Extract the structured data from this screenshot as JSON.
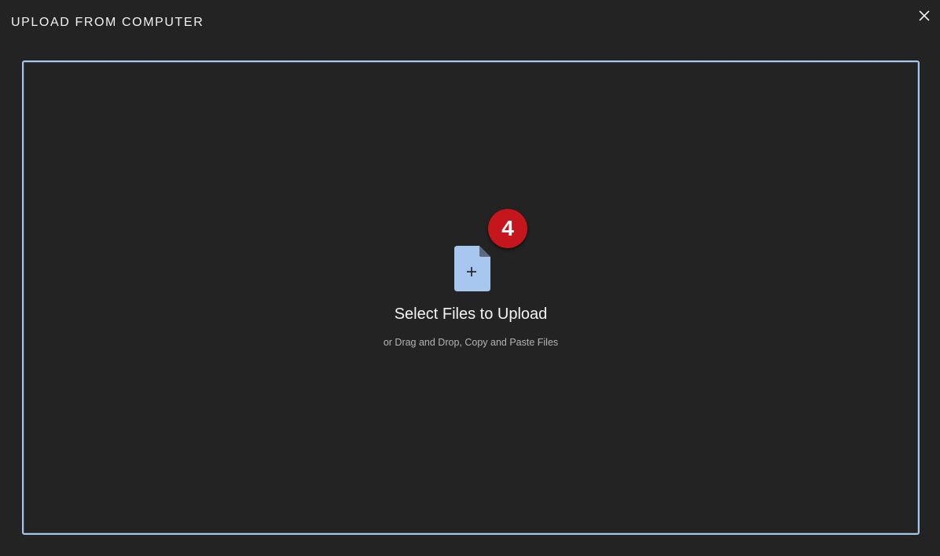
{
  "dialog": {
    "title": "UPLOAD FROM COMPUTER",
    "close_icon": "close-icon"
  },
  "dropzone": {
    "icon": "file-add-icon",
    "badge": "4",
    "title": "Select Files to Upload",
    "subtitle": "or Drag and Drop, Copy and Paste Files"
  },
  "colors": {
    "background": "#232323",
    "border": "#a8c7e8",
    "icon": "#a8c7f0",
    "badge": "#c4161c"
  }
}
